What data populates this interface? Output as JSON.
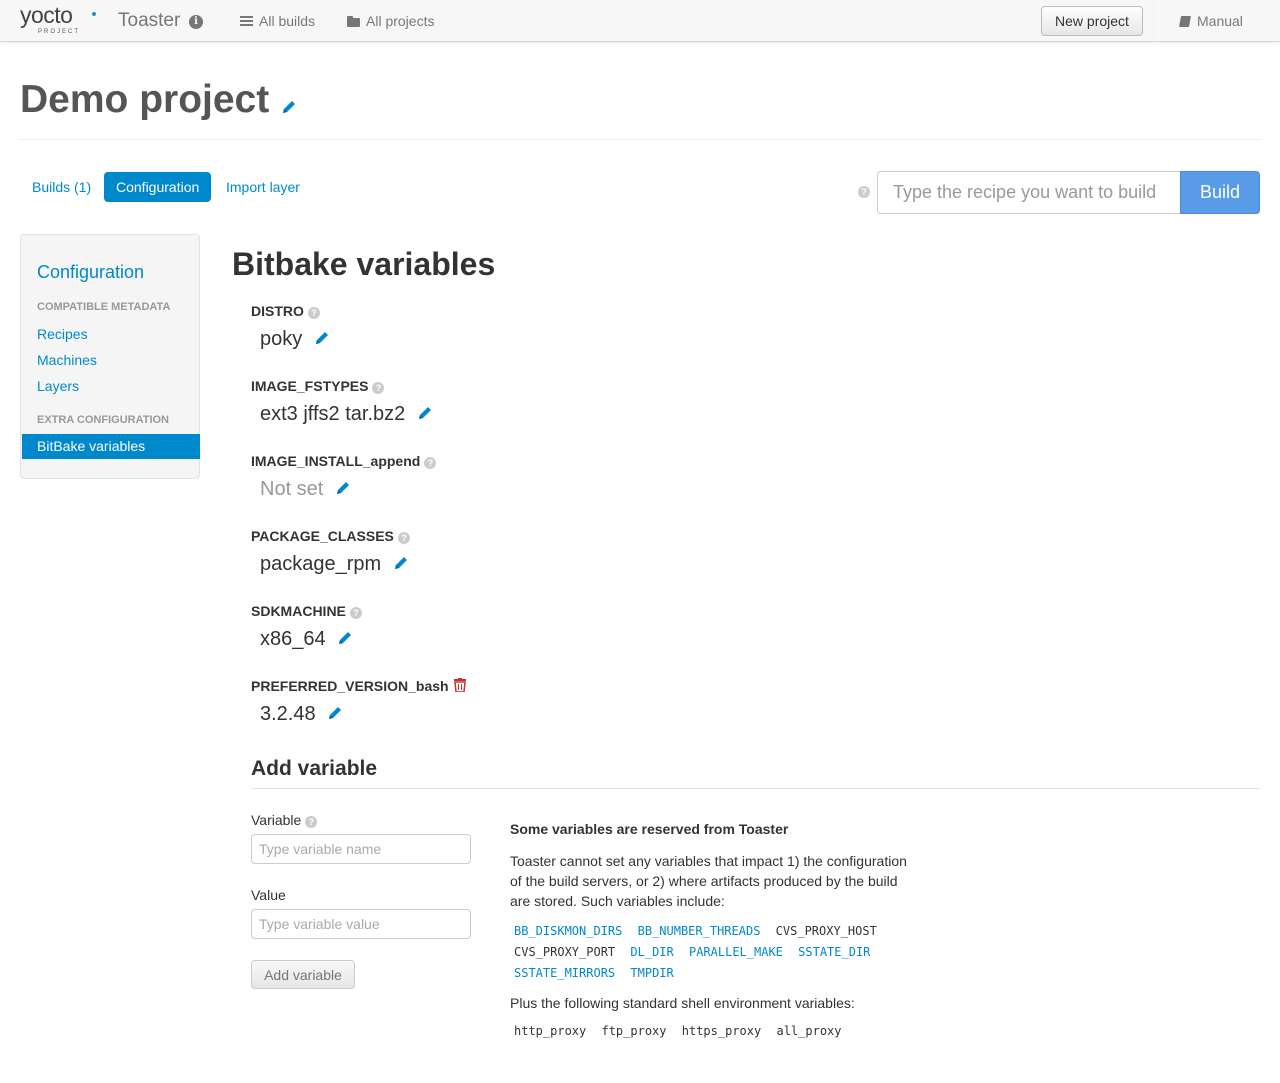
{
  "navbar": {
    "logo_word": "yocto",
    "logo_sub": "PROJECT",
    "brand": "Toaster",
    "all_builds": "All builds",
    "all_projects": "All projects",
    "new_project": "New project",
    "manual": "Manual"
  },
  "project": {
    "title": "Demo project"
  },
  "tabs": {
    "builds": "Builds (1)",
    "configuration": "Configuration",
    "import_layer": "Import layer"
  },
  "build_form": {
    "placeholder": "Type the recipe you want to build",
    "button": "Build"
  },
  "sidebar": {
    "heading": "Configuration",
    "section1": "Compatible metadata",
    "recipes": "Recipes",
    "machines": "Machines",
    "layers": "Layers",
    "section2": "Extra configuration",
    "bitbake_variables": "BitBake variables"
  },
  "main": {
    "title": "Bitbake variables",
    "variables": [
      {
        "name": "DISTRO",
        "value": "poky"
      },
      {
        "name": "IMAGE_FSTYPES",
        "value": "ext3 jffs2 tar.bz2"
      },
      {
        "name": "IMAGE_INSTALL_append",
        "value": "Not set"
      },
      {
        "name": "PACKAGE_CLASSES",
        "value": "package_rpm"
      },
      {
        "name": "SDKMACHINE",
        "value": "x86_64"
      },
      {
        "name": "PREFERRED_VERSION_bash",
        "value": "3.2.48"
      }
    ]
  },
  "add_variable": {
    "title": "Add variable",
    "variable_label": "Variable",
    "variable_placeholder": "Type variable name",
    "value_label": "Value",
    "value_placeholder": "Type variable value",
    "button": "Add variable"
  },
  "reserved": {
    "title": "Some variables are reserved from Toaster",
    "text": "Toaster cannot set any variables that impact 1) the configuration of the build servers, or 2) where artifacts produced by the build are stored. Such variables include:",
    "vars": [
      "BB_DISKMON_DIRS",
      "BB_NUMBER_THREADS",
      "CVS_PROXY_HOST",
      "CVS_PROXY_PORT",
      "DL_DIR",
      "PARALLEL_MAKE",
      "SSTATE_DIR",
      "SSTATE_MIRRORS",
      "TMPDIR"
    ],
    "plus_text": "Plus the following standard shell environment variables:",
    "shell_vars": [
      "http_proxy",
      "ftp_proxy",
      "https_proxy",
      "all_proxy"
    ]
  },
  "colors": {
    "accent": "#0088cc",
    "build_button": "#5a9be8",
    "delete": "#c9302c"
  }
}
